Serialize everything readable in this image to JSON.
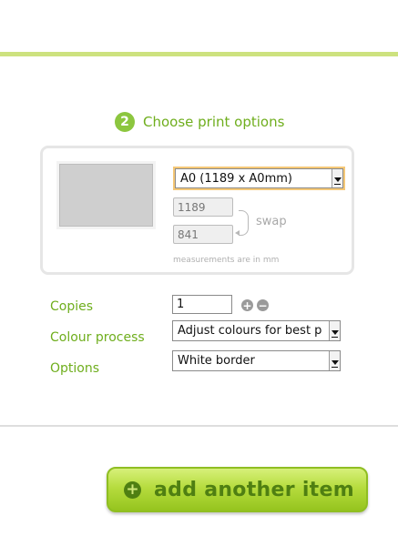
{
  "step": {
    "number": "2",
    "title": "Choose print options"
  },
  "print_options": {
    "paper_size": "A0 (1189 x A0mm)",
    "width": "1189",
    "height": "841",
    "swap_label": "swap",
    "measurement_note": "measurements are in mm"
  },
  "form": {
    "copies_label": "Copies",
    "copies_value": "1",
    "plus_symbol": "+",
    "minus_symbol": "−",
    "colour_label": "Colour process",
    "colour_value": "Adjust colours for best p",
    "options_label": "Options",
    "options_value": "White border"
  },
  "actions": {
    "add_icon": "+",
    "add_label": "add another item"
  },
  "colors": {
    "accent_green": "#6fae1d",
    "top_bar": "#cde27f",
    "button_green": "#b6dc3e"
  }
}
